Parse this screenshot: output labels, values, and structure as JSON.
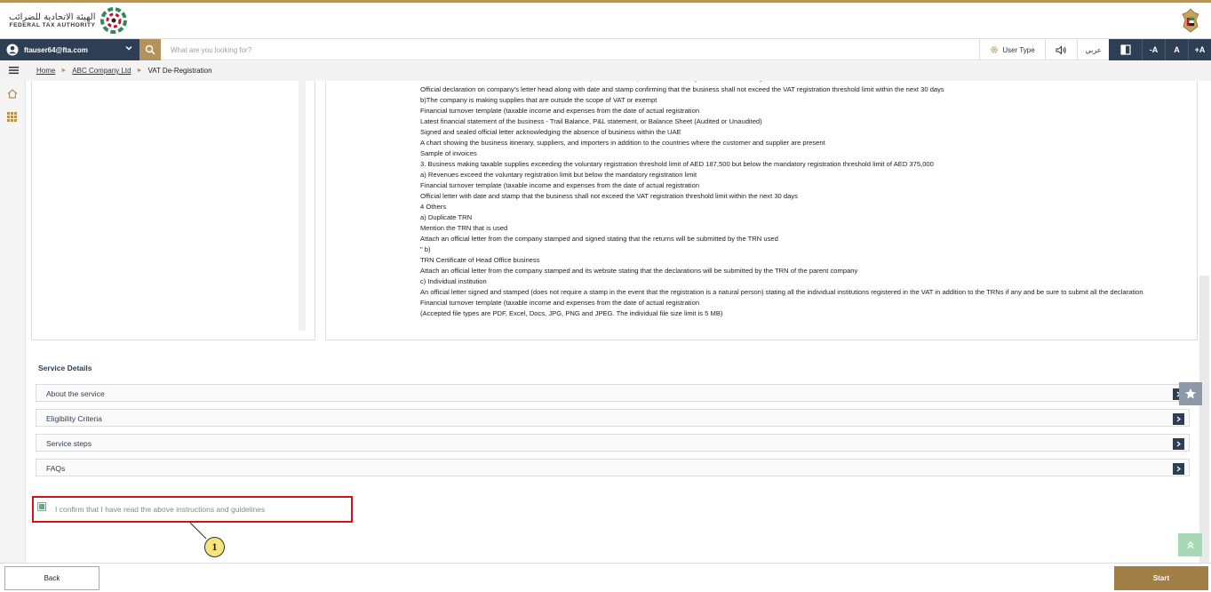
{
  "header": {
    "logo_ar": "الهيئة الاتحادية للضرائب",
    "logo_en": "FEDERAL TAX AUTHORITY"
  },
  "toolbar": {
    "user_email": "ftauser64@fta.com",
    "search_placeholder": "What are you looking for?",
    "user_type": "User Type",
    "lang": "عربي",
    "font_decrease": "-A",
    "font_normal": "A",
    "font_increase": "+A"
  },
  "breadcrumb": {
    "home": "Home",
    "company": "ABC Company Ltd",
    "current": "VAT De-Registration"
  },
  "doc_lines": [
    "Latest financial statement of the business - Trail Balance, P&L statement, or Balance Sheet (Audited or Unaudited)",
    "Official declaration on company's letter head along with date and stamp confirming that the business shall not exceed the VAT registration threshold limit within the next 30 days",
    "b)The company is making supplies that are outside the scope of VAT or exempt",
    "Financial turnover template (taxable income and expenses from the date of actual registration",
    "Latest financial statement of the business - Trail Balance, P&L statement, or Balance Sheet (Audited or Unaudited)",
    "Signed and sealed official letter acknowledging the absence of business within the UAE",
    "A chart showing the business itinerary, suppliers, and importers in addition to the countries where the customer and supplier are present",
    "Sample of invoices",
    "3. Business making taxable supplies exceeding the voluntary registration threshold limit of AED 187,500 but below the mandatory registration threshold limit of AED 375,000",
    "a) Revenues exceed the voluntary registration limit but below the mandatory registration limit",
    "Financial turnover template (taxable income and expenses from the date of actual registration",
    "Official letter with date and stamp that the business shall not exceed the VAT registration threshold limit within the next 30 days",
    "4 Others",
    "a) Duplicate TRN",
    "Mention the TRN that is used",
    "Attach an official letter from the company stamped and signed stating that the returns will be submitted by the TRN used",
    "\"  b)",
    "TRN Certificate of Head Office business",
    "Attach an official letter from the company stamped and its website stating that the declarations will be submitted by the TRN of the parent company",
    "c) Individual institution"
  ],
  "doc_wrap_line": "An official letter signed and stamped (does not require a stamp in the event that the registration is a natural person) stating all the individual institutions registered in the VAT in addition to the TRNs if any and be sure to submit all the declaration",
  "doc_tail_lines": [
    "Financial turnover template (taxable income and expenses from the date of actual registration",
    "(Accepted file types are PDF, Excel, Docs, JPG, PNG and JPEG. The individual file size limit is 5 MB)"
  ],
  "service": {
    "title": "Service Details",
    "sections": [
      "About the service",
      "Eligibility Criteria",
      "Service steps",
      "FAQs"
    ]
  },
  "confirm": {
    "label": "I confirm that I have read the above instructions and guidelines",
    "callout": "1"
  },
  "footer": {
    "back": "Back",
    "start": "Start"
  },
  "colors": {
    "navy": "#2e3e55",
    "gold": "#b4925b",
    "start": "#a17e46",
    "highlight": "#d0131b"
  }
}
